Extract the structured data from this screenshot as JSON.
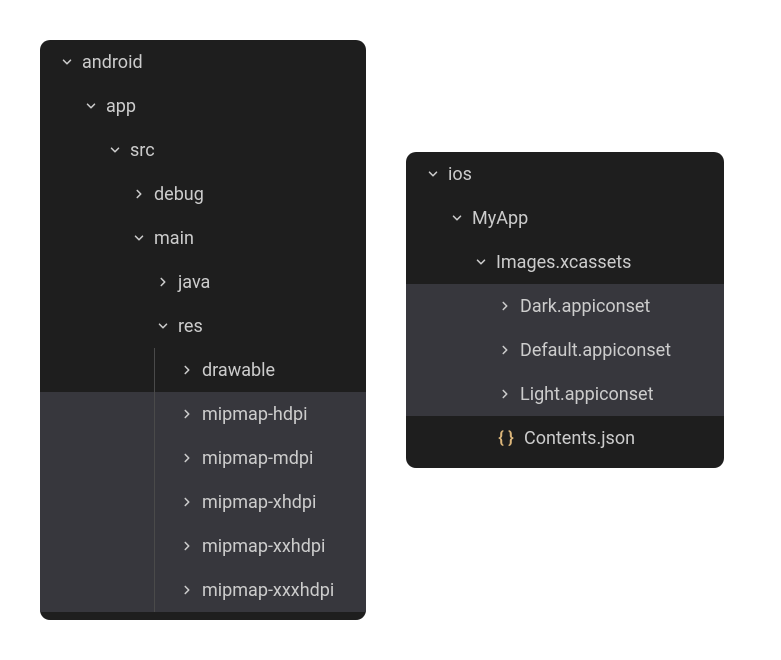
{
  "android_tree": {
    "nodes": [
      {
        "label": "android",
        "indent": 0,
        "expanded": true,
        "type": "folder",
        "selected": false,
        "guides": []
      },
      {
        "label": "app",
        "indent": 1,
        "expanded": true,
        "type": "folder",
        "selected": false,
        "guides": []
      },
      {
        "label": "src",
        "indent": 2,
        "expanded": true,
        "type": "folder",
        "selected": false,
        "guides": []
      },
      {
        "label": "debug",
        "indent": 3,
        "expanded": false,
        "type": "folder",
        "selected": false,
        "guides": []
      },
      {
        "label": "main",
        "indent": 3,
        "expanded": true,
        "type": "folder",
        "selected": false,
        "guides": []
      },
      {
        "label": "java",
        "indent": 4,
        "expanded": false,
        "type": "folder",
        "selected": false,
        "guides": []
      },
      {
        "label": "res",
        "indent": 4,
        "expanded": true,
        "type": "folder",
        "selected": false,
        "guides": []
      },
      {
        "label": "drawable",
        "indent": 5,
        "expanded": false,
        "type": "folder",
        "selected": false,
        "guides": [
          114
        ]
      },
      {
        "label": "mipmap-hdpi",
        "indent": 5,
        "expanded": false,
        "type": "folder",
        "selected": true,
        "guides": [
          114
        ]
      },
      {
        "label": "mipmap-mdpi",
        "indent": 5,
        "expanded": false,
        "type": "folder",
        "selected": true,
        "guides": [
          114
        ]
      },
      {
        "label": "mipmap-xhdpi",
        "indent": 5,
        "expanded": false,
        "type": "folder",
        "selected": true,
        "guides": [
          114
        ]
      },
      {
        "label": "mipmap-xxhdpi",
        "indent": 5,
        "expanded": false,
        "type": "folder",
        "selected": true,
        "guides": [
          114
        ]
      },
      {
        "label": "mipmap-xxxhdpi",
        "indent": 5,
        "expanded": false,
        "type": "folder",
        "selected": true,
        "guides": [
          114
        ]
      }
    ]
  },
  "ios_tree": {
    "nodes": [
      {
        "label": "ios",
        "indent": 0,
        "expanded": true,
        "type": "folder",
        "selected": false,
        "guides": []
      },
      {
        "label": "MyApp",
        "indent": 1,
        "expanded": true,
        "type": "folder",
        "selected": false,
        "guides": []
      },
      {
        "label": "Images.xcassets",
        "indent": 2,
        "expanded": true,
        "type": "folder",
        "selected": false,
        "guides": []
      },
      {
        "label": "Dark.appiconset",
        "indent": 3,
        "expanded": false,
        "type": "folder",
        "selected": true,
        "guides": []
      },
      {
        "label": "Default.appiconset",
        "indent": 3,
        "expanded": false,
        "type": "folder",
        "selected": true,
        "guides": []
      },
      {
        "label": "Light.appiconset",
        "indent": 3,
        "expanded": false,
        "type": "folder",
        "selected": true,
        "guides": []
      },
      {
        "label": "Contents.json",
        "indent": 3,
        "expanded": null,
        "type": "json",
        "selected": false,
        "guides": []
      }
    ]
  },
  "icons": {
    "json": "{ }"
  }
}
